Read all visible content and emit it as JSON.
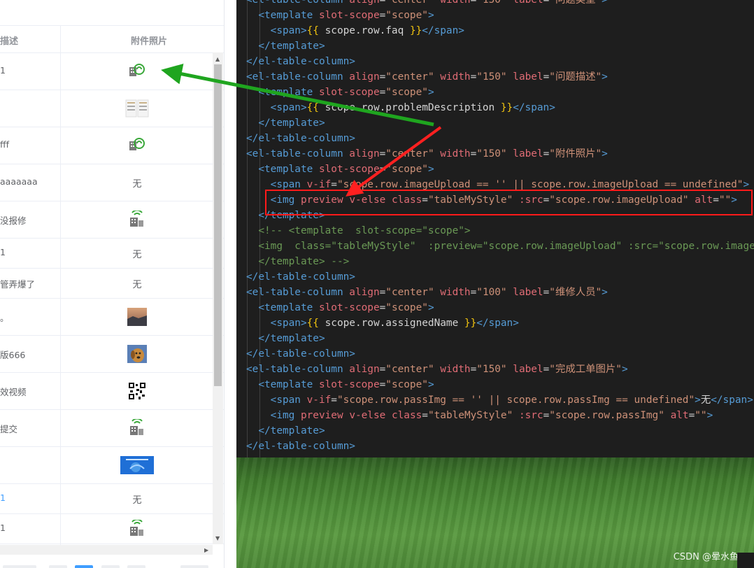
{
  "table": {
    "headers": [
      "描述",
      "附件照片"
    ],
    "rows": [
      {
        "desc": "1",
        "attachment": "",
        "icon": "building-image-icon"
      },
      {
        "desc": "",
        "attachment": "",
        "icon": "document-thumbnail"
      },
      {
        "desc": "fff",
        "attachment": "",
        "icon": "building-image-icon"
      },
      {
        "desc": "aaaaaaa",
        "attachment": "无",
        "icon": ""
      },
      {
        "desc": "没报修",
        "attachment": "",
        "icon": "building-signal-icon"
      },
      {
        "desc": "1",
        "attachment": "无",
        "icon": ""
      },
      {
        "desc": "管弄爆了",
        "attachment": "无",
        "icon": ""
      },
      {
        "desc": "。",
        "attachment": "",
        "icon": "sunset-photo-thumbnail"
      },
      {
        "desc": "版666",
        "attachment": "",
        "icon": "dog-photo-thumbnail"
      },
      {
        "desc": "效视频",
        "attachment": "",
        "icon": "qr-code-thumbnail"
      },
      {
        "desc": "提交",
        "attachment": "",
        "icon": "building-signal-icon"
      },
      {
        "desc": "",
        "attachment": "",
        "icon": "blue-banner-thumbnail"
      },
      {
        "desc": "1",
        "attachment": "无",
        "icon": ""
      },
      {
        "desc": "1",
        "attachment": "",
        "icon": "building-signal-icon"
      }
    ]
  },
  "code": {
    "lines": [
      [
        [
          "t",
          "<el-table-column "
        ],
        [
          "an",
          "align"
        ],
        [
          "mu",
          "="
        ],
        [
          "at",
          "\"center\""
        ],
        [
          "mu",
          " "
        ],
        [
          "an",
          "width"
        ],
        [
          "mu",
          "="
        ],
        [
          "at",
          "\"150\""
        ],
        [
          "mu",
          " "
        ],
        [
          "an",
          "label"
        ],
        [
          "mu",
          "="
        ],
        [
          "at",
          "\"问题类型\""
        ],
        [
          "t",
          ">"
        ]
      ],
      [
        [
          "mu",
          "  "
        ],
        [
          "t",
          "<template "
        ],
        [
          "an",
          "slot-scope"
        ],
        [
          "mu",
          "="
        ],
        [
          "at",
          "\"scope\""
        ],
        [
          "t",
          ">"
        ]
      ],
      [
        [
          "mu",
          "    "
        ],
        [
          "t",
          "<span>"
        ],
        [
          "yl",
          "{{"
        ],
        [
          "mu",
          " scope.row.faq "
        ],
        [
          "yl",
          "}}"
        ],
        [
          "t",
          "</span>"
        ]
      ],
      [
        [
          "mu",
          "  "
        ],
        [
          "t",
          "</template>"
        ]
      ],
      [
        [
          "t",
          "</el-table-column>"
        ]
      ],
      [
        [
          "t",
          "<el-table-column "
        ],
        [
          "an",
          "align"
        ],
        [
          "mu",
          "="
        ],
        [
          "at",
          "\"center\""
        ],
        [
          "mu",
          " "
        ],
        [
          "an",
          "width"
        ],
        [
          "mu",
          "="
        ],
        [
          "at",
          "\"150\""
        ],
        [
          "mu",
          " "
        ],
        [
          "an",
          "label"
        ],
        [
          "mu",
          "="
        ],
        [
          "at",
          "\"问题描述\""
        ],
        [
          "t",
          ">"
        ]
      ],
      [
        [
          "mu",
          "  "
        ],
        [
          "t",
          "<template "
        ],
        [
          "an",
          "slot-scope"
        ],
        [
          "mu",
          "="
        ],
        [
          "at",
          "\"scope\""
        ],
        [
          "t",
          ">"
        ]
      ],
      [
        [
          "mu",
          "    "
        ],
        [
          "t",
          "<span>"
        ],
        [
          "yl",
          "{{"
        ],
        [
          "mu",
          " scope.row.problemDescription "
        ],
        [
          "yl",
          "}}"
        ],
        [
          "t",
          "</span>"
        ]
      ],
      [
        [
          "mu",
          "  "
        ],
        [
          "t",
          "</template>"
        ]
      ],
      [
        [
          "t",
          "</el-table-column>"
        ]
      ],
      [
        [
          "t",
          "<el-table-column "
        ],
        [
          "an",
          "align"
        ],
        [
          "mu",
          "="
        ],
        [
          "at",
          "\"center\""
        ],
        [
          "mu",
          " "
        ],
        [
          "an",
          "width"
        ],
        [
          "mu",
          "="
        ],
        [
          "at",
          "\"150\""
        ],
        [
          "mu",
          " "
        ],
        [
          "an",
          "label"
        ],
        [
          "mu",
          "="
        ],
        [
          "at",
          "\"附件照片\""
        ],
        [
          "t",
          ">"
        ]
      ],
      [
        [
          "mu",
          "  "
        ],
        [
          "t",
          "<template "
        ],
        [
          "an",
          "slot-scope"
        ],
        [
          "mu",
          "="
        ],
        [
          "at",
          "\"scope\""
        ],
        [
          "t",
          ">"
        ]
      ],
      [
        [
          "mu",
          "    "
        ],
        [
          "t",
          "<span "
        ],
        [
          "an",
          "v-if"
        ],
        [
          "mu",
          "="
        ],
        [
          "at",
          "\"scope.row.imageUpload == '' || scope.row.imageUpload == undefined\""
        ],
        [
          "t",
          ">"
        ]
      ],
      [
        [
          "mu",
          "    "
        ],
        [
          "t",
          "<img "
        ],
        [
          "an",
          "preview"
        ],
        [
          "mu",
          " "
        ],
        [
          "an",
          "v-else"
        ],
        [
          "mu",
          " "
        ],
        [
          "an",
          "class"
        ],
        [
          "mu",
          "="
        ],
        [
          "at",
          "\"tableMyStyle\""
        ],
        [
          "mu",
          " "
        ],
        [
          "an",
          ":src"
        ],
        [
          "mu",
          "="
        ],
        [
          "at",
          "\"scope.row.imageUpload\""
        ],
        [
          "mu",
          " "
        ],
        [
          "an",
          "alt"
        ],
        [
          "mu",
          "="
        ],
        [
          "at",
          "\"\""
        ],
        [
          "t",
          ">"
        ]
      ],
      [
        [
          "mu",
          "  "
        ],
        [
          "t",
          "</template>"
        ]
      ],
      [
        [
          "mu",
          "  "
        ],
        [
          "cm",
          "<!-- <template  slot-scope=\"scope\">"
        ]
      ],
      [
        [
          "mu",
          "  "
        ],
        [
          "cm",
          "<img  class=\"tableMyStyle\"  :preview=\"scope.row.imageUpload\" :src=\"scope.row.imageUpload\""
        ]
      ],
      [
        [
          "mu",
          "  "
        ],
        [
          "cm",
          "</template> -->"
        ]
      ],
      [
        [
          "t",
          "</el-table-column>"
        ]
      ],
      [
        [
          "t",
          "<el-table-column "
        ],
        [
          "an",
          "align"
        ],
        [
          "mu",
          "="
        ],
        [
          "at",
          "\"center\""
        ],
        [
          "mu",
          " "
        ],
        [
          "an",
          "width"
        ],
        [
          "mu",
          "="
        ],
        [
          "at",
          "\"100\""
        ],
        [
          "mu",
          " "
        ],
        [
          "an",
          "label"
        ],
        [
          "mu",
          "="
        ],
        [
          "at",
          "\"维修人员\""
        ],
        [
          "t",
          ">"
        ]
      ],
      [
        [
          "mu",
          "  "
        ],
        [
          "t",
          "<template "
        ],
        [
          "an",
          "slot-scope"
        ],
        [
          "mu",
          "="
        ],
        [
          "at",
          "\"scope\""
        ],
        [
          "t",
          ">"
        ]
      ],
      [
        [
          "mu",
          "    "
        ],
        [
          "t",
          "<span>"
        ],
        [
          "yl",
          "{{"
        ],
        [
          "mu",
          " scope.row.assignedName "
        ],
        [
          "yl",
          "}}"
        ],
        [
          "t",
          "</span>"
        ]
      ],
      [
        [
          "mu",
          "  "
        ],
        [
          "t",
          "</template>"
        ]
      ],
      [
        [
          "t",
          "</el-table-column>"
        ]
      ],
      [
        [
          "t",
          "<el-table-column "
        ],
        [
          "an",
          "align"
        ],
        [
          "mu",
          "="
        ],
        [
          "at",
          "\"center\""
        ],
        [
          "mu",
          " "
        ],
        [
          "an",
          "width"
        ],
        [
          "mu",
          "="
        ],
        [
          "at",
          "\"150\""
        ],
        [
          "mu",
          " "
        ],
        [
          "an",
          "label"
        ],
        [
          "mu",
          "="
        ],
        [
          "at",
          "\"完成工单图片\""
        ],
        [
          "t",
          ">"
        ]
      ],
      [
        [
          "mu",
          "  "
        ],
        [
          "t",
          "<template "
        ],
        [
          "an",
          "slot-scope"
        ],
        [
          "mu",
          "="
        ],
        [
          "at",
          "\"scope\""
        ],
        [
          "t",
          ">"
        ]
      ],
      [
        [
          "mu",
          "    "
        ],
        [
          "t",
          "<span "
        ],
        [
          "an",
          "v-if"
        ],
        [
          "mu",
          "="
        ],
        [
          "at",
          "\"scope.row.passImg == '' || scope.row.passImg == undefined\""
        ],
        [
          "t",
          ">"
        ],
        [
          "mu",
          "无"
        ],
        [
          "t",
          "</span>"
        ]
      ],
      [
        [
          "mu",
          "    "
        ],
        [
          "t",
          "<img "
        ],
        [
          "an",
          "preview"
        ],
        [
          "mu",
          " "
        ],
        [
          "an",
          "v-else"
        ],
        [
          "mu",
          " "
        ],
        [
          "an",
          "class"
        ],
        [
          "mu",
          "="
        ],
        [
          "at",
          "\"tableMyStyle\""
        ],
        [
          "mu",
          " "
        ],
        [
          "an",
          ":src"
        ],
        [
          "mu",
          "="
        ],
        [
          "at",
          "\"scope.row.passImg\""
        ],
        [
          "mu",
          " "
        ],
        [
          "an",
          "alt"
        ],
        [
          "mu",
          "="
        ],
        [
          "at",
          "\"\""
        ],
        [
          "t",
          ">"
        ]
      ],
      [
        [
          "mu",
          "  "
        ],
        [
          "t",
          "</template>"
        ]
      ],
      [
        [
          "t",
          "</el-table-column>"
        ]
      ]
    ]
  },
  "watermark": "CSDN @晕水鱼",
  "colors": {
    "arrow_green": "#1fa51f",
    "arrow_red": "#ff2020",
    "highlight_border": "#ff1a1a"
  }
}
